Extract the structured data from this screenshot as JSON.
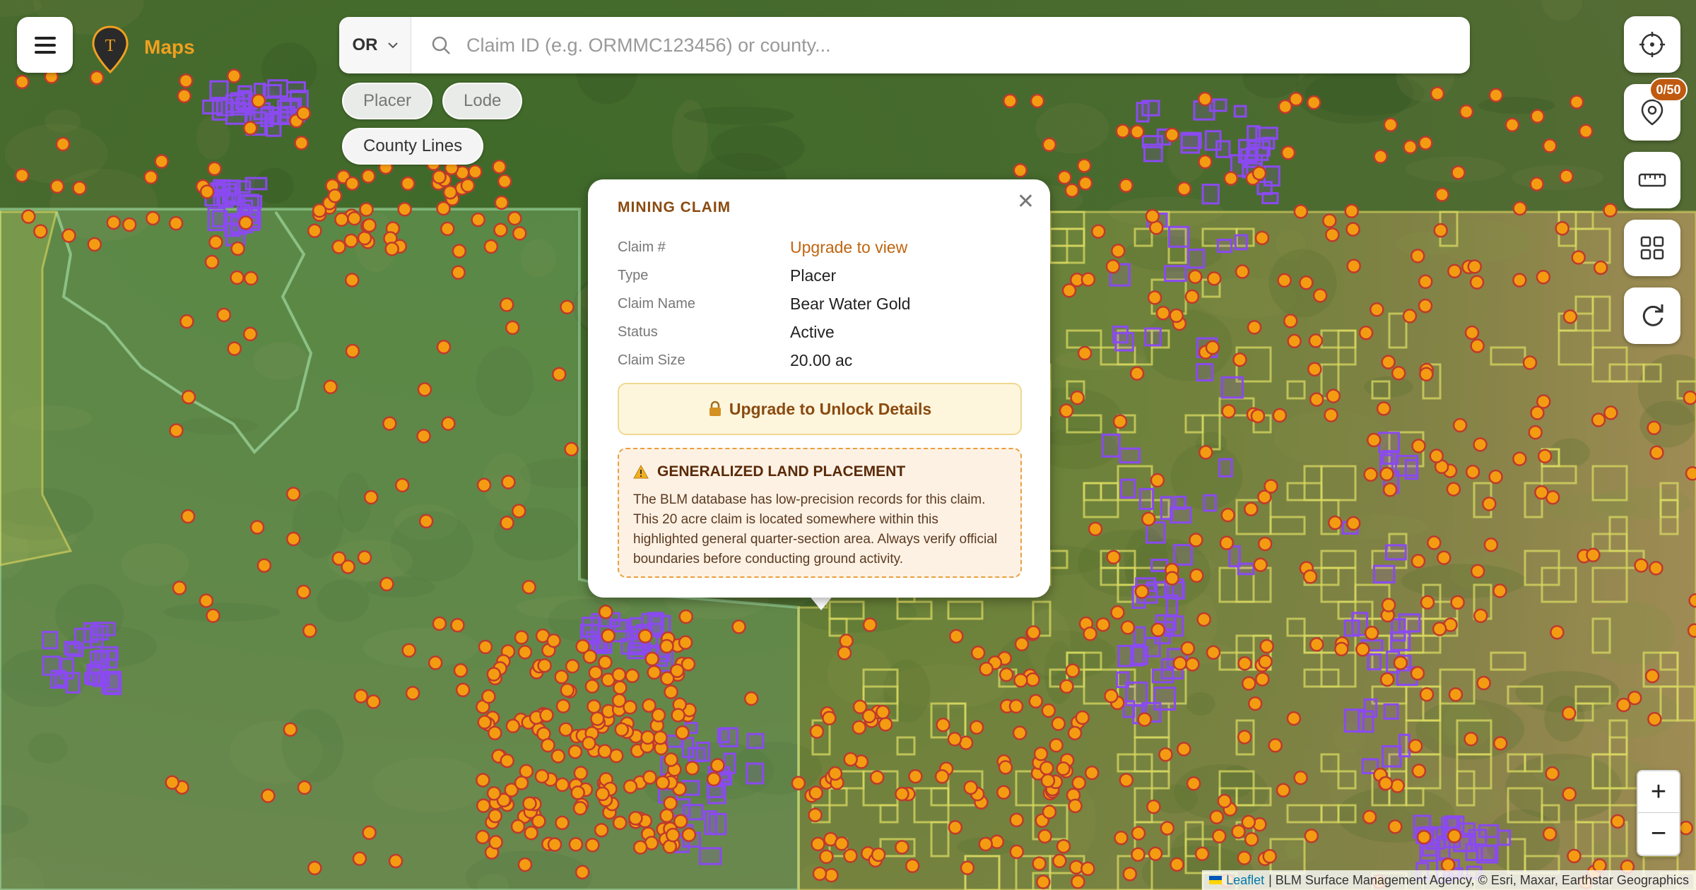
{
  "header": {
    "logo_text": "Maps",
    "state_select": "OR",
    "search_placeholder": "Claim ID (e.g. ORMMC123456) or county..."
  },
  "filters": {
    "chips": [
      {
        "label": "Placer",
        "active": false
      },
      {
        "label": "Lode",
        "active": false
      },
      {
        "label": "County Lines",
        "active": true
      }
    ]
  },
  "controls": {
    "waypoint_badge": "0/50",
    "zoom_in": "+",
    "zoom_out": "−"
  },
  "popup": {
    "title": "MINING CLAIM",
    "rows": [
      {
        "key": "Claim #",
        "value": "Upgrade to view"
      },
      {
        "key": "Type",
        "value": "Placer"
      },
      {
        "key": "Claim Name",
        "value": "Bear Water Gold"
      },
      {
        "key": "Status",
        "value": "Active"
      },
      {
        "key": "Claim Size",
        "value": "20.00 ac"
      }
    ],
    "unlock_label": "Upgrade to Unlock Details",
    "warning_title": "GENERALIZED LAND PLACEMENT",
    "warning_text": "The BLM database has low-precision records for this claim. This 20 acre claim is located somewhere within this highlighted general quarter-section area. Always verify official boundaries before conducting ground activity."
  },
  "attribution": {
    "leaflet": "Leaflet",
    "text": "| BLM Surface Management Agency, © Esri, Maxar, Earthstar Geographics"
  },
  "colors": {
    "claim_point": "#f39c12",
    "claim_point_stroke": "#c0392b",
    "claim_polygon": "#8a4af0",
    "blm_land": "#d8d860",
    "forest_land": "#7fb87a",
    "accent": "#c0650f"
  }
}
